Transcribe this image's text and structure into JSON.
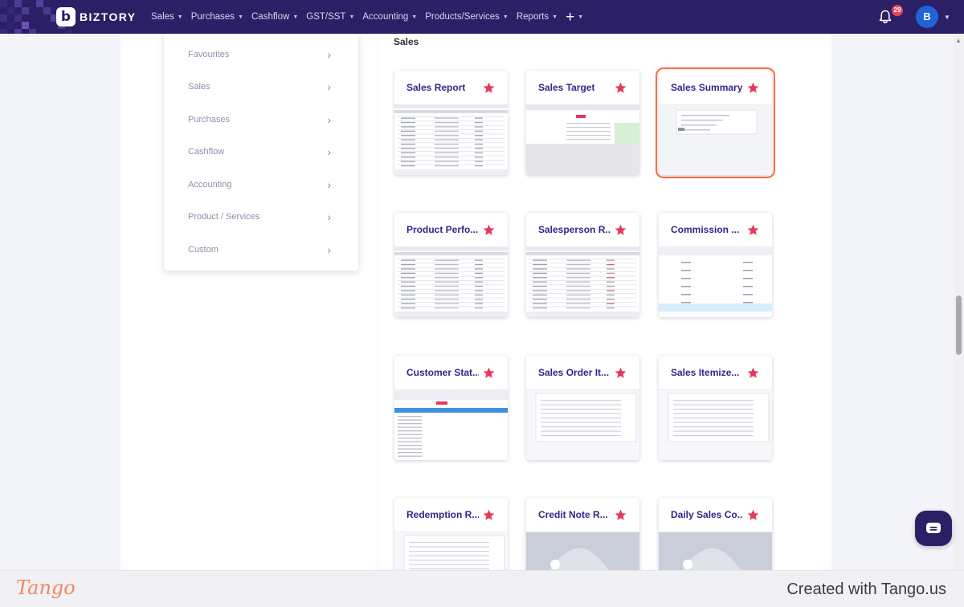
{
  "app": {
    "brand": "BIZTORY",
    "logo_letter": "b",
    "nav": [
      {
        "label": "Sales",
        "id": "sales"
      },
      {
        "label": "Purchases",
        "id": "purchases"
      },
      {
        "label": "Cashflow",
        "id": "cashflow"
      },
      {
        "label": "GST/SST",
        "id": "gst-sst"
      },
      {
        "label": "Accounting",
        "id": "accounting"
      },
      {
        "label": "Products/Services",
        "id": "products-services"
      },
      {
        "label": "Reports",
        "id": "reports"
      }
    ],
    "plus_label": "+",
    "notification_count": "29",
    "avatar_initial": "B"
  },
  "sidebar": {
    "items": [
      {
        "label": "Favourites"
      },
      {
        "label": "Sales"
      },
      {
        "label": "Purchases"
      },
      {
        "label": "Cashflow"
      },
      {
        "label": "Accounting"
      },
      {
        "label": "Product / Services"
      },
      {
        "label": "Custom"
      }
    ],
    "chevron": "›"
  },
  "main": {
    "section_title": "Sales",
    "cards": [
      {
        "title": "Sales Report",
        "thumb": "report"
      },
      {
        "title": "Sales Target",
        "thumb": "target"
      },
      {
        "title": "Sales Summary",
        "thumb": "summary",
        "selected": true
      },
      {
        "title": "Product Perfo...",
        "thumb": "report"
      },
      {
        "title": "Salesperson R...",
        "thumb": "grid"
      },
      {
        "title": "Commission ...",
        "thumb": "commission"
      },
      {
        "title": "Customer Stat...",
        "thumb": "statement"
      },
      {
        "title": "Sales Order It...",
        "thumb": "order"
      },
      {
        "title": "Sales Itemize...",
        "thumb": "itemize"
      },
      {
        "title": "Redemption R...",
        "thumb": "redemption"
      },
      {
        "title": "Credit Note R...",
        "thumb": "placeholder"
      },
      {
        "title": "Daily Sales Co...",
        "thumb": "placeholder"
      }
    ]
  },
  "footer": {
    "logo_text": "Tango",
    "credit": "Created with Tango.us"
  },
  "colors": {
    "nav_bg": "#2b1f66",
    "card_title": "#3a1f8a",
    "star": "#e8365d",
    "selection": "#ff6a3d",
    "badge": "#e8425f",
    "avatar": "#1f63d6"
  }
}
